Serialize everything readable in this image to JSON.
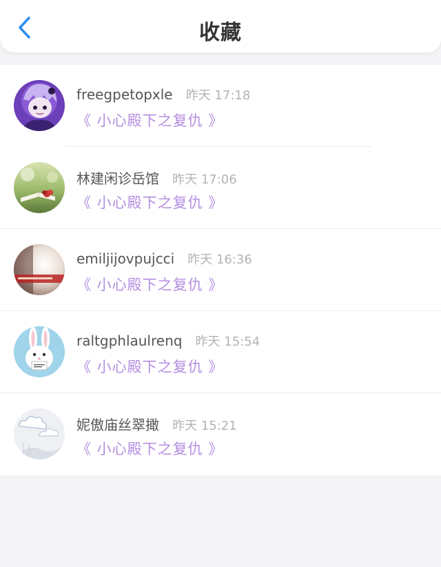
{
  "header": {
    "title": "收藏",
    "back_icon": "chevron-left-icon",
    "accent_color": "#2a8cf0"
  },
  "favorites": [
    {
      "username": "freegpetopxle",
      "time": "昨天 17:18",
      "book": "《 小心殿下之复仇 》",
      "avatar": "anime-character-purple"
    },
    {
      "username": "林建闲诊岳馆",
      "time": "昨天 17:06",
      "book": "《 小心殿下之复仇 》",
      "avatar": "book-with-flowers-green"
    },
    {
      "username": "emiljijovpujcci",
      "time": "昨天 16:36",
      "book": "《 小心殿下之复仇 》",
      "avatar": "photo-light-red-text"
    },
    {
      "username": "raltgphlaulrenq",
      "time": "昨天 15:54",
      "book": "《 小心殿下之复仇 》",
      "avatar": "white-rabbit-blue"
    },
    {
      "username": "妮傲庙丝翠撖",
      "time": "昨天 15:21",
      "book": "《 小心殿下之复仇 》",
      "avatar": "white-cloud-fabric"
    }
  ],
  "colors": {
    "book_title": "#b48ee0",
    "username": "#555555",
    "time": "#b3b3b3",
    "background": "#f4f4f6"
  }
}
